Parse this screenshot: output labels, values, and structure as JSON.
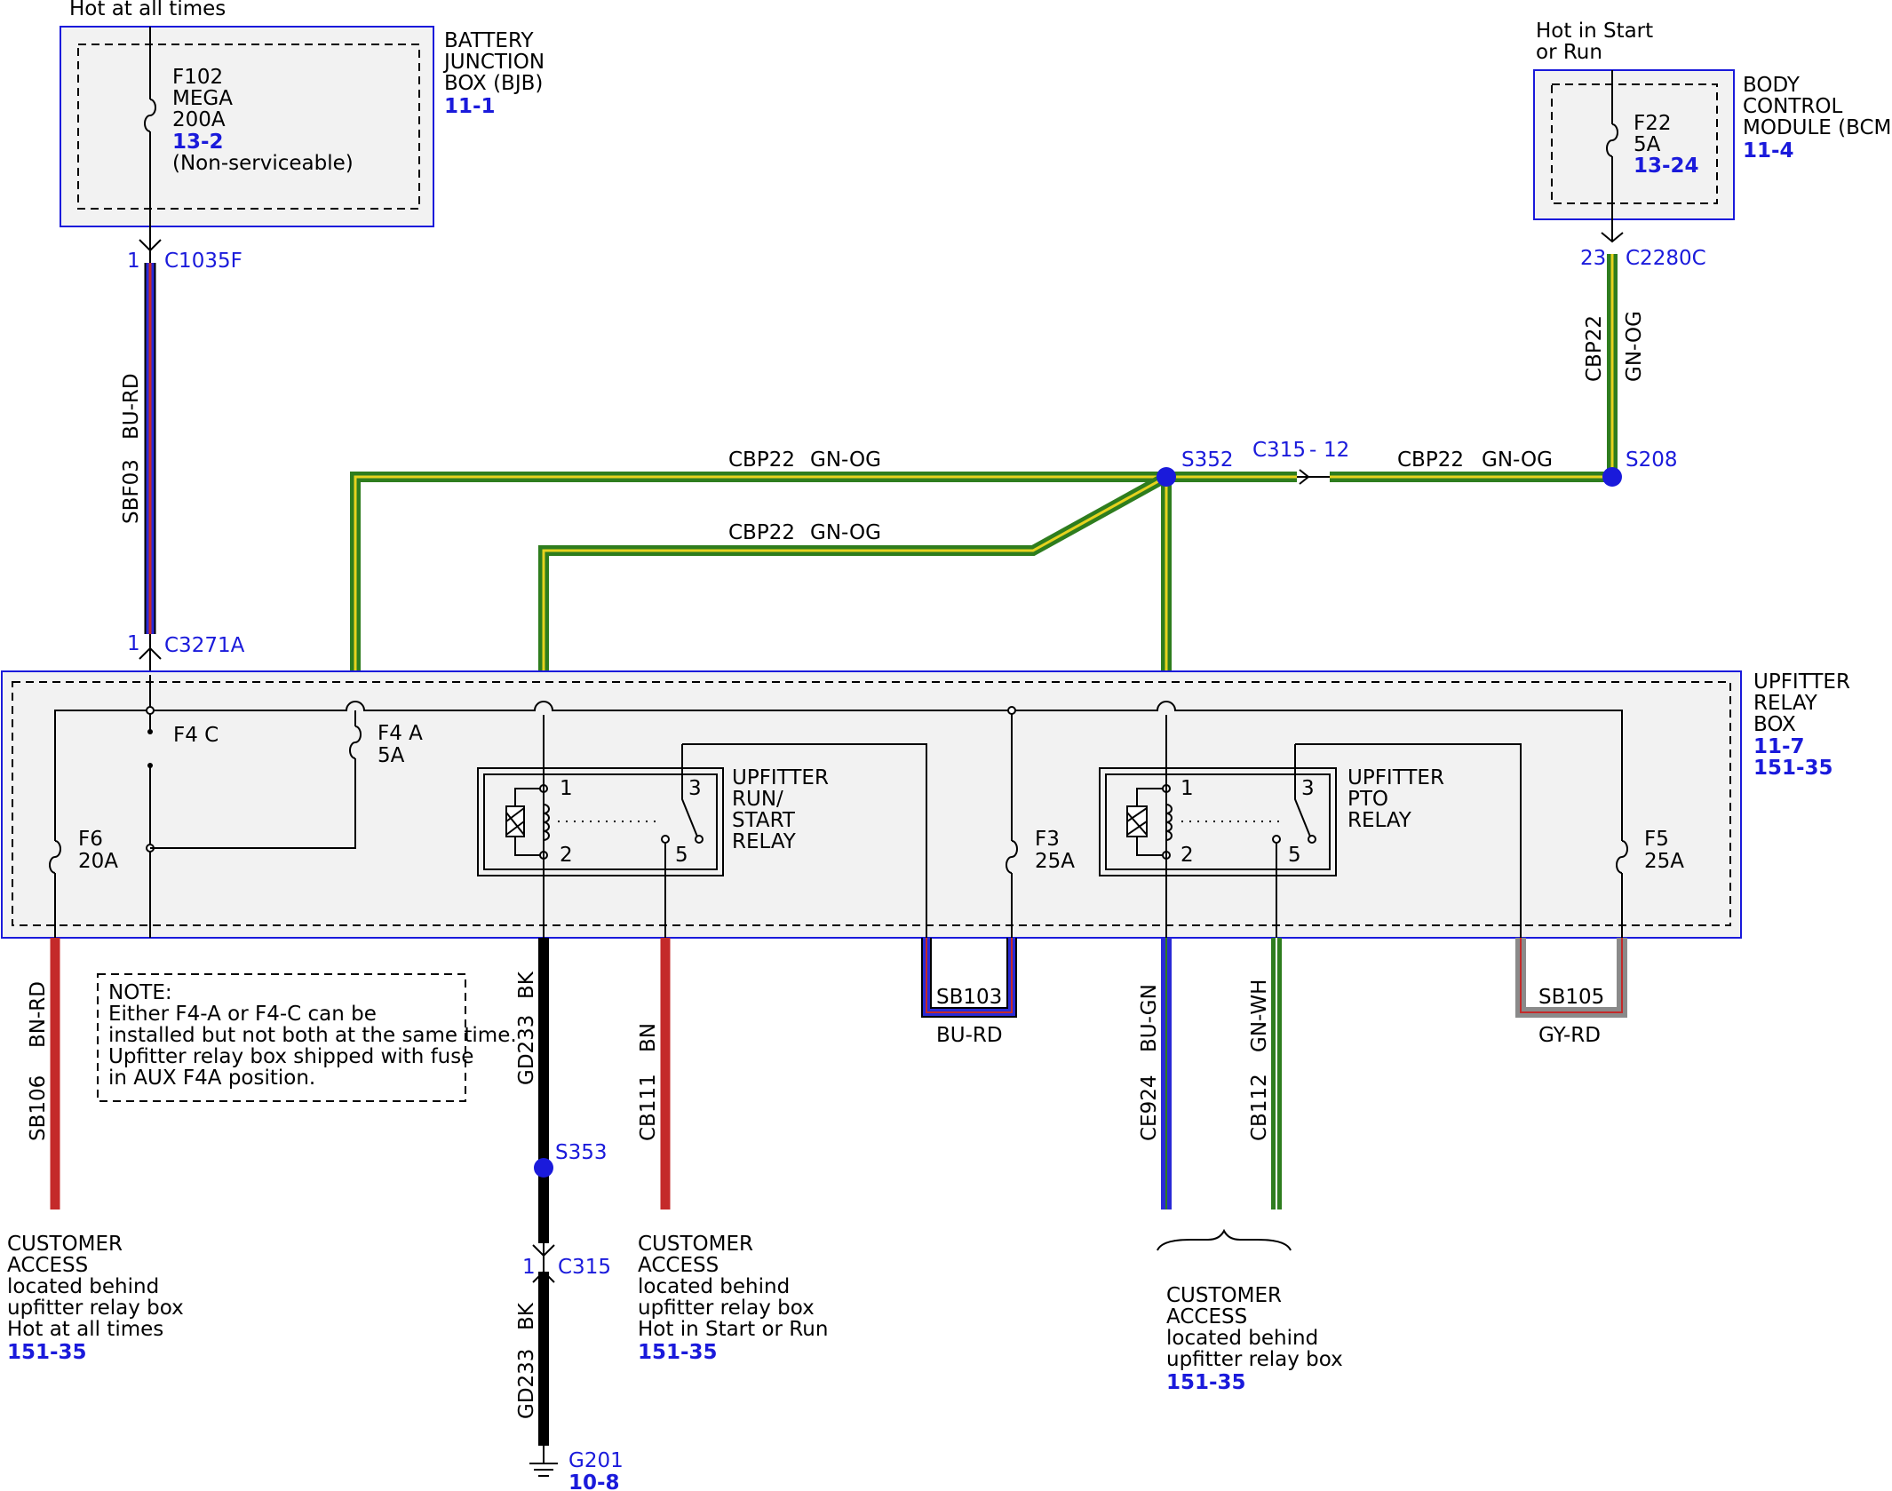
{
  "bjb": {
    "top_note": "Hot at all times",
    "fuse_lines": [
      "F102",
      "MEGA",
      "200A"
    ],
    "fuse_ref": "13-2",
    "fuse_note": "(Non-serviceable)",
    "label_lines": [
      "BATTERY",
      "JUNCTION",
      "BOX (BJB)"
    ],
    "ref": "11-1"
  },
  "bcm": {
    "top_note_lines": [
      "Hot in Start",
      "or Run"
    ],
    "fuse_lines": [
      "F22",
      "5A"
    ],
    "fuse_ref": "13-24",
    "label_lines": [
      "BODY",
      "CONTROL",
      "MODULE (BCM)"
    ],
    "ref": "11-4"
  },
  "connectors": {
    "c1035f": {
      "pin": "1",
      "name": "C1035F"
    },
    "c3271a": {
      "pin": "1",
      "name": "C3271A"
    },
    "c2280c": {
      "pin": "23",
      "name": "C2280C"
    },
    "c315_inline": {
      "name": "C315",
      "sep": "-",
      "pin": "12"
    },
    "c315": {
      "pin": "1",
      "name": "C315"
    }
  },
  "wires": {
    "sbf03": {
      "circuit": "SBF03",
      "color": "BU-RD"
    },
    "cbp22_bcm": {
      "circuit": "CBP22",
      "color": "GN-OG"
    },
    "cbp22_top": {
      "circuit": "CBP22",
      "color": "GN-OG"
    },
    "cbp22_mid": {
      "circuit": "CBP22",
      "color": "GN-OG"
    },
    "cbp22_right": {
      "circuit": "CBP22",
      "color": "GN-OG"
    },
    "sb106": {
      "circuit": "SB106",
      "color": "BN-RD"
    },
    "gd233_a": {
      "circuit": "GD233",
      "color": "BK"
    },
    "gd233_b": {
      "circuit": "GD233",
      "color": "BK"
    },
    "cb111": {
      "circuit": "CB111",
      "color": "BN"
    },
    "sb103": {
      "circuit": "SB103",
      "color": "BU-RD"
    },
    "ce924": {
      "circuit": "CE924",
      "color": "BU-GN"
    },
    "cb112": {
      "circuit": "CB112",
      "color": "GN-WH"
    },
    "sb105": {
      "circuit": "SB105",
      "color": "GY-RD"
    }
  },
  "splices": {
    "s352": "S352",
    "s208": "S208",
    "s353": "S353"
  },
  "ground": {
    "name": "G201",
    "ref": "10-8"
  },
  "relay_box": {
    "label_lines": [
      "UPFITTER",
      "RELAY",
      "BOX"
    ],
    "refs": [
      "11-7",
      "151-35"
    ],
    "f4c": "F4 C",
    "f4a": [
      "F4 A",
      "5A"
    ],
    "f6": [
      "F6",
      "20A"
    ],
    "f3": [
      "F3",
      "25A"
    ],
    "f5": [
      "F5",
      "25A"
    ],
    "relay1": {
      "label_lines": [
        "UPFITTER",
        "RUN/",
        "START",
        "RELAY"
      ],
      "pins": [
        "1",
        "2",
        "3",
        "5"
      ]
    },
    "relay2": {
      "label_lines": [
        "UPFITTER",
        "PTO",
        "RELAY"
      ],
      "pins": [
        "1",
        "2",
        "3",
        "5"
      ]
    }
  },
  "note_lines": [
    "NOTE:",
    "Either F4-A or F4-C can be",
    "installed but not both at the same time.",
    "Upfitter relay box shipped with fuse",
    "in AUX F4A position."
  ],
  "access_left": {
    "lines": [
      "CUSTOMER",
      "ACCESS",
      "located behind",
      "upfitter relay box",
      "Hot at all times"
    ],
    "ref": "151-35"
  },
  "access_mid": {
    "lines": [
      "CUSTOMER",
      "ACCESS",
      "located behind",
      "upfitter relay box",
      "Hot in Start or Run"
    ],
    "ref": "151-35"
  },
  "access_right": {
    "lines": [
      "CUSTOMER",
      "ACCESS",
      "located behind",
      "upfitter relay box"
    ],
    "ref": "151-35"
  },
  "colors": {
    "blue_label": "#1a1adb",
    "wire_blue": "#2a2ad6",
    "wire_red": "#c42a2a",
    "wire_green": "#2e7d1e",
    "wire_yellow": "#e6d21e",
    "wire_gray": "#8a8a8a",
    "wire_black": "#000000",
    "box_fill": "#f2f2f2"
  }
}
